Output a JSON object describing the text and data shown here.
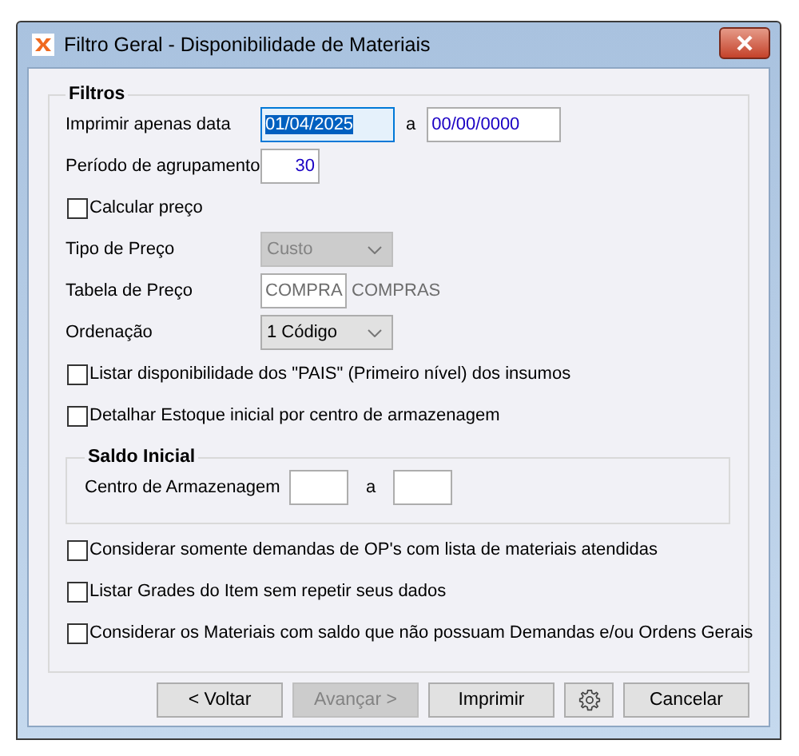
{
  "window": {
    "title": "Filtro Geral - Disponibilidade de Materiais"
  },
  "filters": {
    "title": "Filtros",
    "items": [
      {
        "kind": "date_range",
        "label": "Imprimir apenas data",
        "from": {
          "value": "01/04/2025",
          "selected": true
        },
        "separator": "a",
        "to": {
          "value": "00/00/0000",
          "selected": false
        }
      },
      {
        "kind": "number",
        "label": "Período de agrupamento",
        "value": "30"
      },
      {
        "kind": "checkbox",
        "label": "Calcular preço",
        "checked": false
      },
      {
        "kind": "select",
        "label": "Tipo de Preço",
        "value": "Custo",
        "disabled": true
      },
      {
        "kind": "code",
        "label": "Tabela de Preço",
        "value": "COMPRA",
        "description": "COMPRAS",
        "disabled": true
      },
      {
        "kind": "select",
        "label": "Ordenação",
        "value": "1 Código",
        "disabled": false
      },
      {
        "kind": "checkbox",
        "label": "Listar disponibilidade dos \"PAIS\" (Primeiro nível) dos insumos",
        "checked": false
      },
      {
        "kind": "checkbox",
        "label": "Detalhar Estoque inicial por centro de armazenagem",
        "checked": false
      },
      {
        "kind": "group",
        "title": "Saldo Inicial",
        "label": "Centro de Armazenagem",
        "separator": "a"
      },
      {
        "kind": "checkbox",
        "label": "Considerar somente demandas de OP's com lista de materiais atendidas",
        "checked": false
      },
      {
        "kind": "checkbox",
        "label": "Listar Grades do Item sem repetir seus dados",
        "checked": false
      },
      {
        "kind": "checkbox",
        "label": "Considerar os Materiais com saldo que não possuam Demandas e/ou Ordens Gerais",
        "checked": false
      }
    ]
  },
  "buttons": [
    {
      "kind": "text",
      "label": "< Voltar",
      "disabled": false
    },
    {
      "kind": "text",
      "label": "Avançar >",
      "disabled": true
    },
    {
      "kind": "text",
      "label": "Imprimir",
      "disabled": false
    },
    {
      "kind": "settings",
      "disabled": false
    },
    {
      "kind": "text",
      "label": "Cancelar",
      "disabled": false
    }
  ]
}
